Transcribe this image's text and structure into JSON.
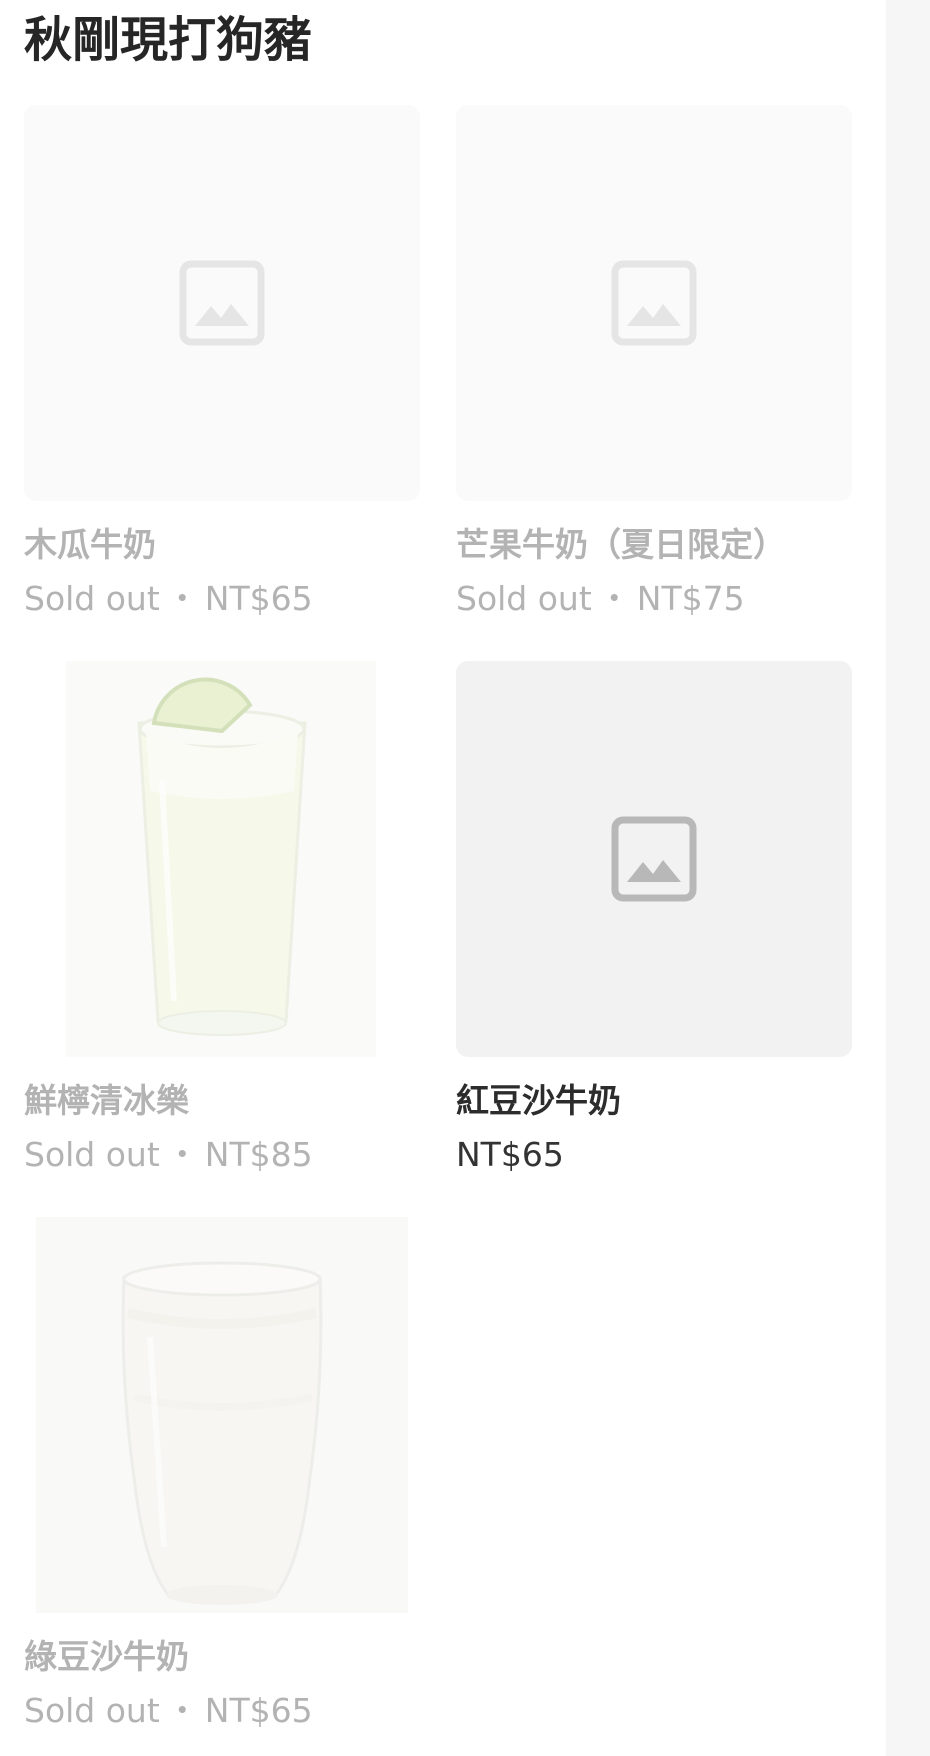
{
  "section": {
    "title": "秋剛現打狗豬"
  },
  "items": [
    {
      "name": "木瓜牛奶",
      "status": "Sold out",
      "separator": "・",
      "price": "NT$65"
    },
    {
      "name": "芒果牛奶（夏日限定）",
      "status": "Sold out",
      "separator": "・",
      "price": "NT$75"
    },
    {
      "name": "鮮檸清冰樂",
      "status": "Sold out",
      "separator": "・",
      "price": "NT$85"
    },
    {
      "name": "紅豆沙牛奶",
      "price": "NT$65"
    },
    {
      "name": "綠豆沙牛奶",
      "status": "Sold out",
      "separator": "・",
      "price": "NT$65"
    }
  ],
  "icons": {
    "placeholder": "image-placeholder-icon"
  },
  "colors": {
    "text": "#262626",
    "soldout_text": "#b3b3b3",
    "placeholder_bg": "#f2f2f2",
    "placeholder_icon": "#bdbdbd"
  }
}
